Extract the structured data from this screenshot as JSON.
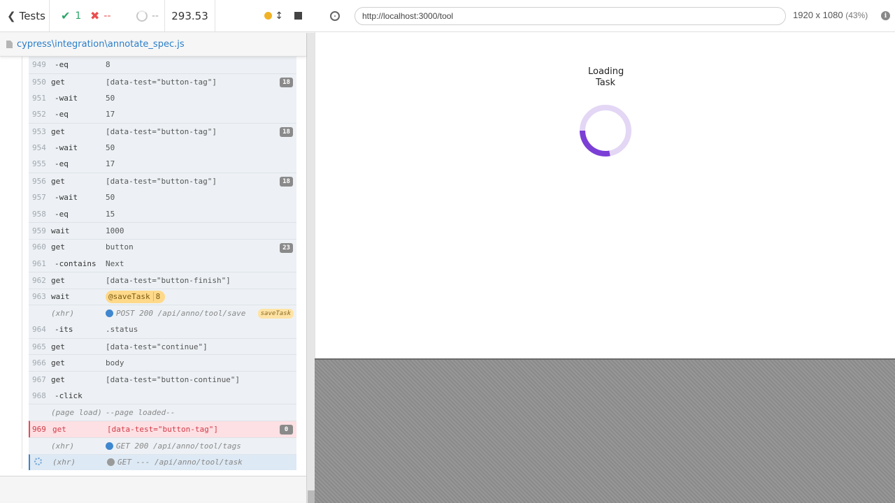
{
  "stats": {
    "tests_label": "Tests",
    "passed": "1",
    "failed": "--",
    "pending": "--",
    "duration": "293.53"
  },
  "spec_path": "cypress\\integration\\annotate_spec.js",
  "commands": [
    {
      "num": "949",
      "name": "-eq",
      "msg": "8",
      "child": true
    },
    {
      "num": "950",
      "name": "get",
      "msg": "[data-test=\"button-tag\"]",
      "badge": "18"
    },
    {
      "num": "951",
      "name": "-wait",
      "msg": "50",
      "child": true
    },
    {
      "num": "952",
      "name": "-eq",
      "msg": "17",
      "child": true
    },
    {
      "num": "953",
      "name": "get",
      "msg": "[data-test=\"button-tag\"]",
      "badge": "18"
    },
    {
      "num": "954",
      "name": "-wait",
      "msg": "50",
      "child": true
    },
    {
      "num": "955",
      "name": "-eq",
      "msg": "17",
      "child": true
    },
    {
      "num": "956",
      "name": "get",
      "msg": "[data-test=\"button-tag\"]",
      "badge": "18"
    },
    {
      "num": "957",
      "name": "-wait",
      "msg": "50",
      "child": true
    },
    {
      "num": "958",
      "name": "-eq",
      "msg": "15",
      "child": true
    },
    {
      "num": "959",
      "name": "wait",
      "msg": "1000"
    },
    {
      "num": "960",
      "name": "get",
      "msg": "button",
      "badge": "23"
    },
    {
      "num": "961",
      "name": "-contains",
      "msg": "Next",
      "child": true
    },
    {
      "num": "962",
      "name": "get",
      "msg": "[data-test=\"button-finish\"]"
    },
    {
      "num": "963",
      "name": "wait",
      "alias": "@saveTask",
      "alias_count": "8"
    },
    {
      "num": "",
      "name": "(xhr)",
      "msg": "POST 200 /api/anno/tool/save",
      "xhr": true,
      "dot": "blue",
      "alias_tag": "saveTask"
    },
    {
      "num": "964",
      "name": "-its",
      "msg": ".status",
      "child": true
    },
    {
      "num": "965",
      "name": "get",
      "msg": "[data-test=\"continue\"]"
    },
    {
      "num": "966",
      "name": "get",
      "msg": "body"
    },
    {
      "num": "967",
      "name": "get",
      "msg": "[data-test=\"button-continue\"]"
    },
    {
      "num": "968",
      "name": "-click",
      "msg": "",
      "child": true
    },
    {
      "num": "",
      "name": "(page load)",
      "msg": "--page loaded--",
      "xhr": true
    },
    {
      "num": "969",
      "name": "get",
      "msg": "[data-test=\"button-tag\"]",
      "badge": "0",
      "state": "failed"
    },
    {
      "num": "",
      "name": "(xhr)",
      "msg": "GET 200 /api/anno/tool/tags",
      "xhr": true,
      "dot": "blue"
    },
    {
      "num": "",
      "name": "(xhr)",
      "msg": "GET --- /api/anno/tool/task",
      "xhr": true,
      "dot": "grey",
      "state": "pending"
    }
  ],
  "aut": {
    "url": "http://localhost:3000/tool",
    "viewport": "1920 x 1080",
    "scale": "(43%)",
    "info_icon": "i",
    "loading_line1": "Loading",
    "loading_line2": "Task"
  },
  "colors": {
    "passed": "#2ca66a",
    "failed": "#e94f4f",
    "running": "#f2b225",
    "spinner_track": "#e3d7f5",
    "spinner_arc": "#7b3fd6"
  }
}
